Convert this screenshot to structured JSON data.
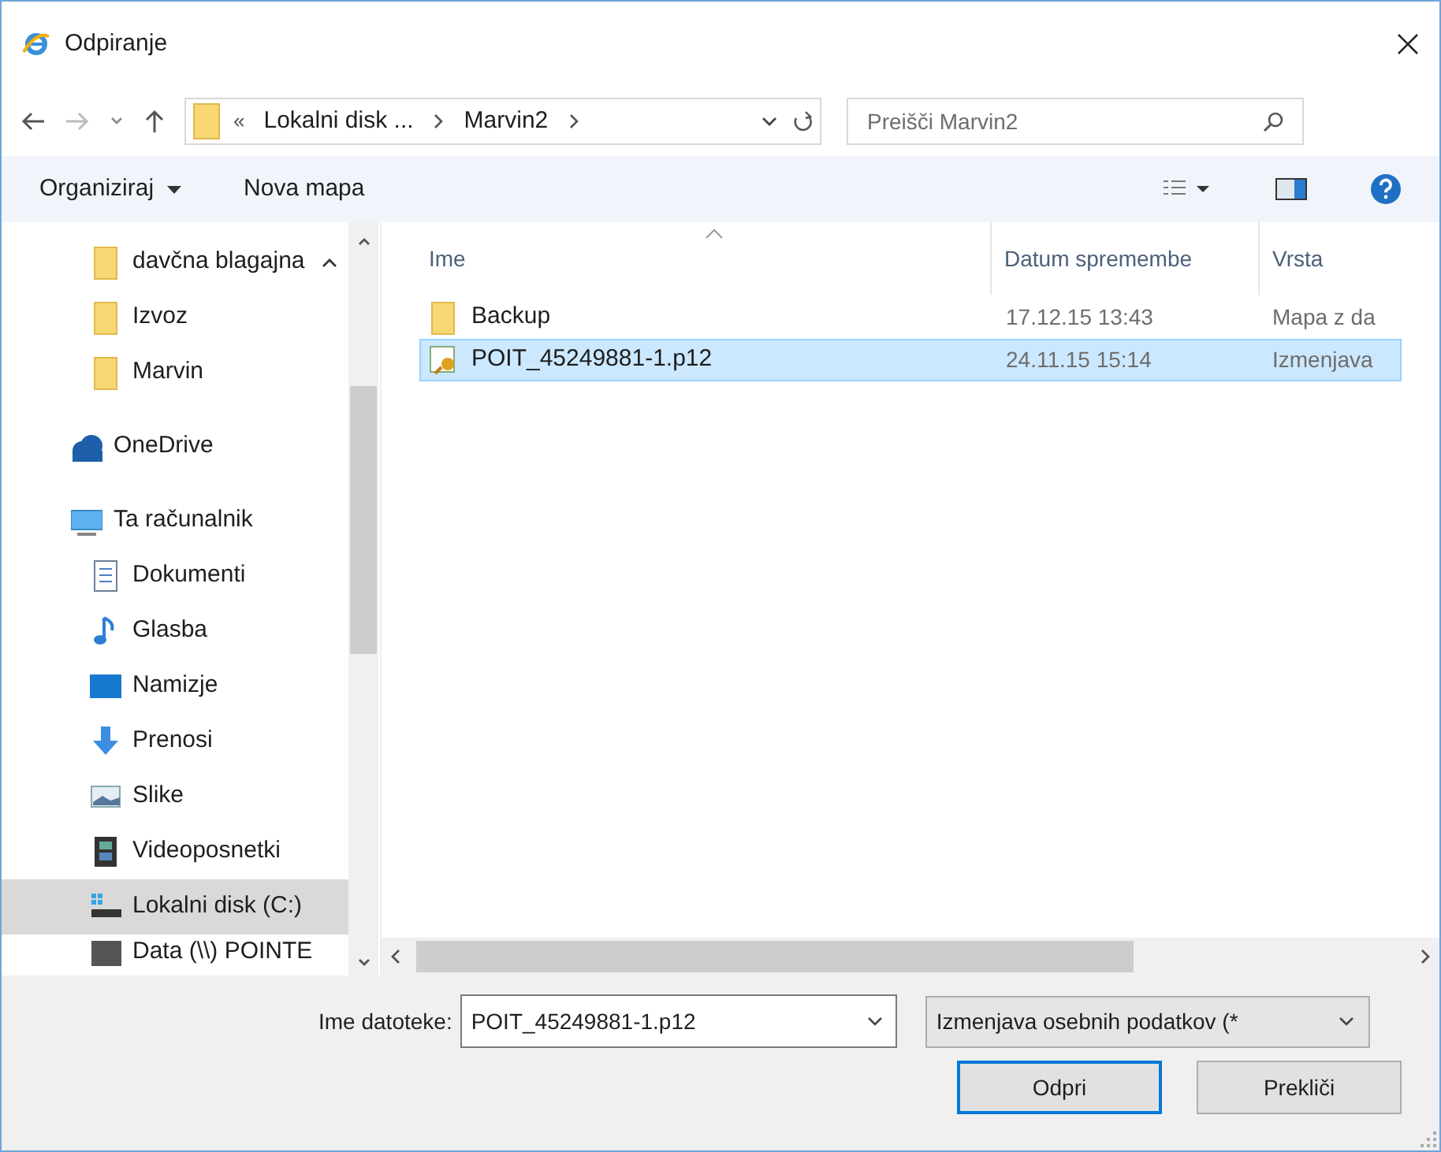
{
  "window": {
    "title": "Odpiranje"
  },
  "address": {
    "overflow": "«",
    "crumbs": [
      "Lokalni disk ...",
      "Marvin2"
    ]
  },
  "search": {
    "placeholder": "Preišči Marvin2"
  },
  "toolbar": {
    "organize": "Organiziraj",
    "new_folder": "Nova mapa"
  },
  "sidebar": {
    "items": [
      {
        "label": "davčna blagajna",
        "kind": "folder",
        "selected": false
      },
      {
        "label": "Izvoz",
        "kind": "folder",
        "selected": false
      },
      {
        "label": "Marvin",
        "kind": "folder",
        "selected": false
      },
      {
        "label": "OneDrive",
        "kind": "cloud",
        "selected": false
      },
      {
        "label": "Ta računalnik",
        "kind": "pc",
        "selected": false,
        "children": [
          {
            "label": "Dokumenti",
            "kind": "docs",
            "selected": false
          },
          {
            "label": "Glasba",
            "kind": "music",
            "selected": false
          },
          {
            "label": "Namizje",
            "kind": "desktop",
            "selected": false
          },
          {
            "label": "Prenosi",
            "kind": "download",
            "selected": false
          },
          {
            "label": "Slike",
            "kind": "pictures",
            "selected": false
          },
          {
            "label": "Videoposnetki",
            "kind": "video",
            "selected": false
          },
          {
            "label": "Lokalni disk (C:)",
            "kind": "drive",
            "selected": true
          },
          {
            "label": "Data (\\\\) POINTE",
            "kind": "netdrive",
            "selected": false
          }
        ]
      }
    ]
  },
  "table": {
    "columns": [
      "Ime",
      "Datum spremembe",
      "Vrsta"
    ],
    "rows": [
      {
        "kind": "folder",
        "cells": [
          "Backup",
          "17.12.15 13:43",
          "Mapa z da"
        ],
        "selected": false
      },
      {
        "kind": "cert",
        "cells": [
          "POIT_45249881-1.p12",
          "24.11.15 15:14",
          "Izmenjava"
        ],
        "selected": true
      }
    ]
  },
  "filename": {
    "label": "Ime datoteke:",
    "value": "POIT_45249881-1.p12"
  },
  "filter": {
    "value": "Izmenjava osebnih podatkov (*"
  },
  "buttons": [
    "Odpri",
    "Prekliči"
  ]
}
